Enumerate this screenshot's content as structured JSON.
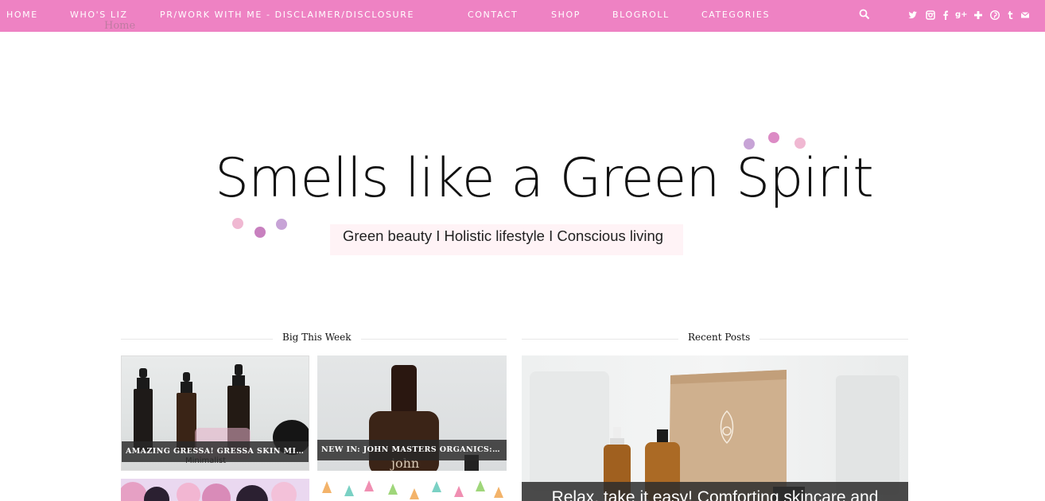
{
  "nav": {
    "items": [
      {
        "label": "HOME"
      },
      {
        "label": "WHO'S LIZ"
      },
      {
        "label": "PR/WORK WITH ME - DISCLAIMER/DISCLOSURE"
      },
      {
        "label": "CONTACT"
      },
      {
        "label": "SHOP"
      },
      {
        "label": "BLOGROLL"
      },
      {
        "label": "CATEGORIES"
      }
    ],
    "search_icon": "search-icon",
    "social": [
      {
        "icon": "twitter-icon",
        "glyph": "𝕥"
      },
      {
        "icon": "instagram-icon",
        "glyph": "◙"
      },
      {
        "icon": "facebook-icon",
        "glyph": "f"
      },
      {
        "icon": "google-plus-icon",
        "glyph": "g+"
      },
      {
        "icon": "bloglovin-icon",
        "glyph": "✚"
      },
      {
        "icon": "pinterest-icon",
        "glyph": "℗"
      },
      {
        "icon": "tumblr-icon",
        "glyph": "t"
      },
      {
        "icon": "email-icon",
        "glyph": "✉"
      }
    ],
    "color": "#ee82c3"
  },
  "breadcrumb": "Home",
  "header": {
    "title": "Smells like a Green Spirit",
    "tagline": "Green beauty I Holistic lifestyle I Conscious living"
  },
  "sections": {
    "big_this_week": {
      "title": "Big This Week",
      "posts": [
        {
          "caption": "AMAZING GRESSA! GRESSA SKIN MINIMALIST..."
        },
        {
          "caption": "NEW IN: JOHN MASTERS ORGANICS: SCALP..."
        }
      ]
    },
    "recent_posts": {
      "title": "Recent Posts",
      "featured_caption": "Relax, take it easy! Comforting skincare and"
    }
  },
  "image_text": {
    "gressa_label": "Minimalist",
    "john_label": "john"
  }
}
